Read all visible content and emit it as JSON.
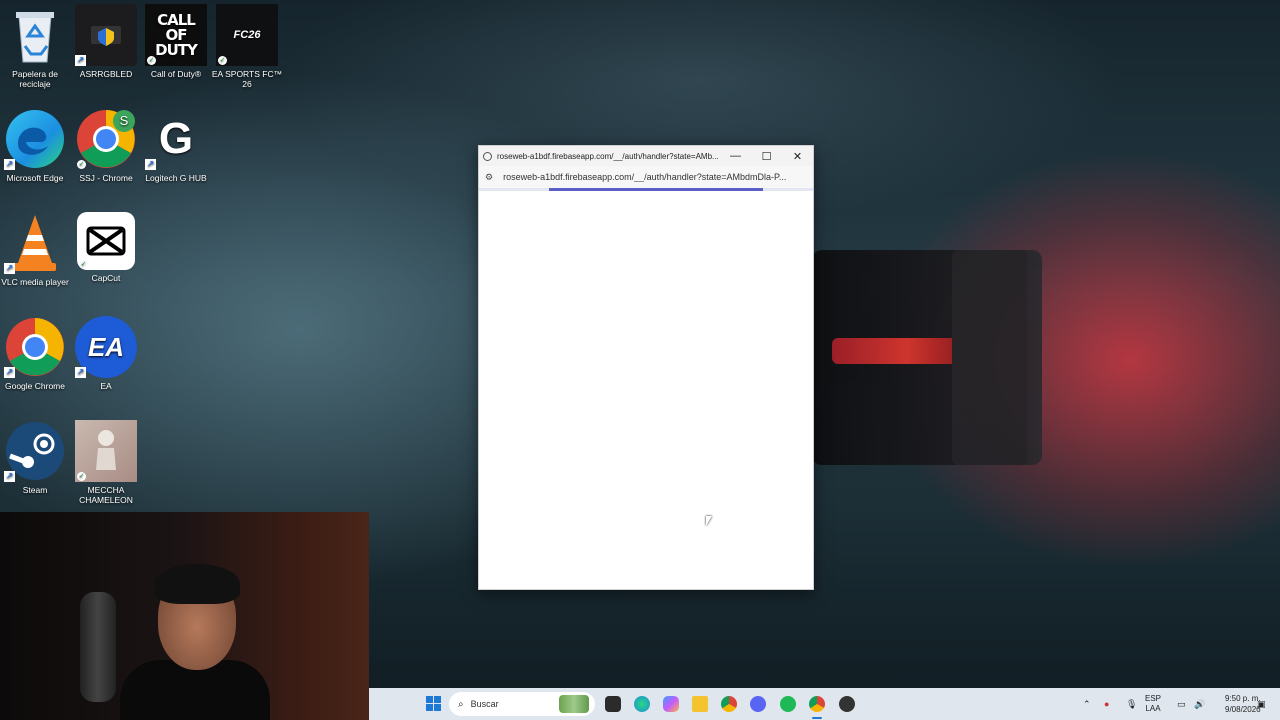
{
  "desktop": {
    "icons": [
      {
        "label": "Papelera de reciclaje",
        "icon": "recycle-bin-icon"
      },
      {
        "label": "ASRRGBLED",
        "icon": "asrock-rgb-icon"
      },
      {
        "label": "Call of Duty®",
        "icon": "call-of-duty-icon",
        "art_text": "CALL OF DUTY"
      },
      {
        "label": "EA SPORTS FC™ 26",
        "icon": "ea-fc26-icon",
        "art_text": "FC26"
      },
      {
        "label": "Microsoft Edge",
        "icon": "edge-icon"
      },
      {
        "label": "SSJ - Chrome",
        "icon": "chrome-profile-icon",
        "badge": "S"
      },
      {
        "label": "Logitech G HUB",
        "icon": "logitech-ghub-icon",
        "art_text": "G"
      },
      {
        "label": "VLC media player",
        "icon": "vlc-icon"
      },
      {
        "label": "CapCut",
        "icon": "capcut-icon"
      },
      {
        "label": "Google Chrome",
        "icon": "chrome-icon"
      },
      {
        "label": "EA",
        "icon": "ea-icon",
        "art_text": "EA"
      },
      {
        "label": "Steam",
        "icon": "steam-icon"
      },
      {
        "label": "MECCHA CHAMELEON",
        "icon": "meccha-chameleon-icon"
      }
    ]
  },
  "popup": {
    "title": "roseweb-a1bdf.firebaseapp.com/__/auth/handler?state=AMb...",
    "url": "roseweb-a1bdf.firebaseapp.com/__/auth/handler?state=AMbdmDla-P...",
    "minimize": "—",
    "maximize": "☐",
    "close": "✕",
    "loading": true
  },
  "taskbar": {
    "search_placeholder": "Buscar",
    "apps": [
      "start-icon",
      "task-view-icon",
      "edge-icon",
      "copilot-icon",
      "file-explorer-icon",
      "chrome-icon",
      "discord-icon",
      "spotify-icon",
      "chrome-profile-icon",
      "unknown-app-icon"
    ],
    "tray": {
      "lang_line1": "ESP",
      "lang_line2": "LAA",
      "time": "9:50 p. m.",
      "date": "9/08/2026"
    }
  },
  "colors": {
    "accent": "#1e78d6",
    "progress": "#5c5fc8",
    "taskbar": "#dfe6ee"
  }
}
